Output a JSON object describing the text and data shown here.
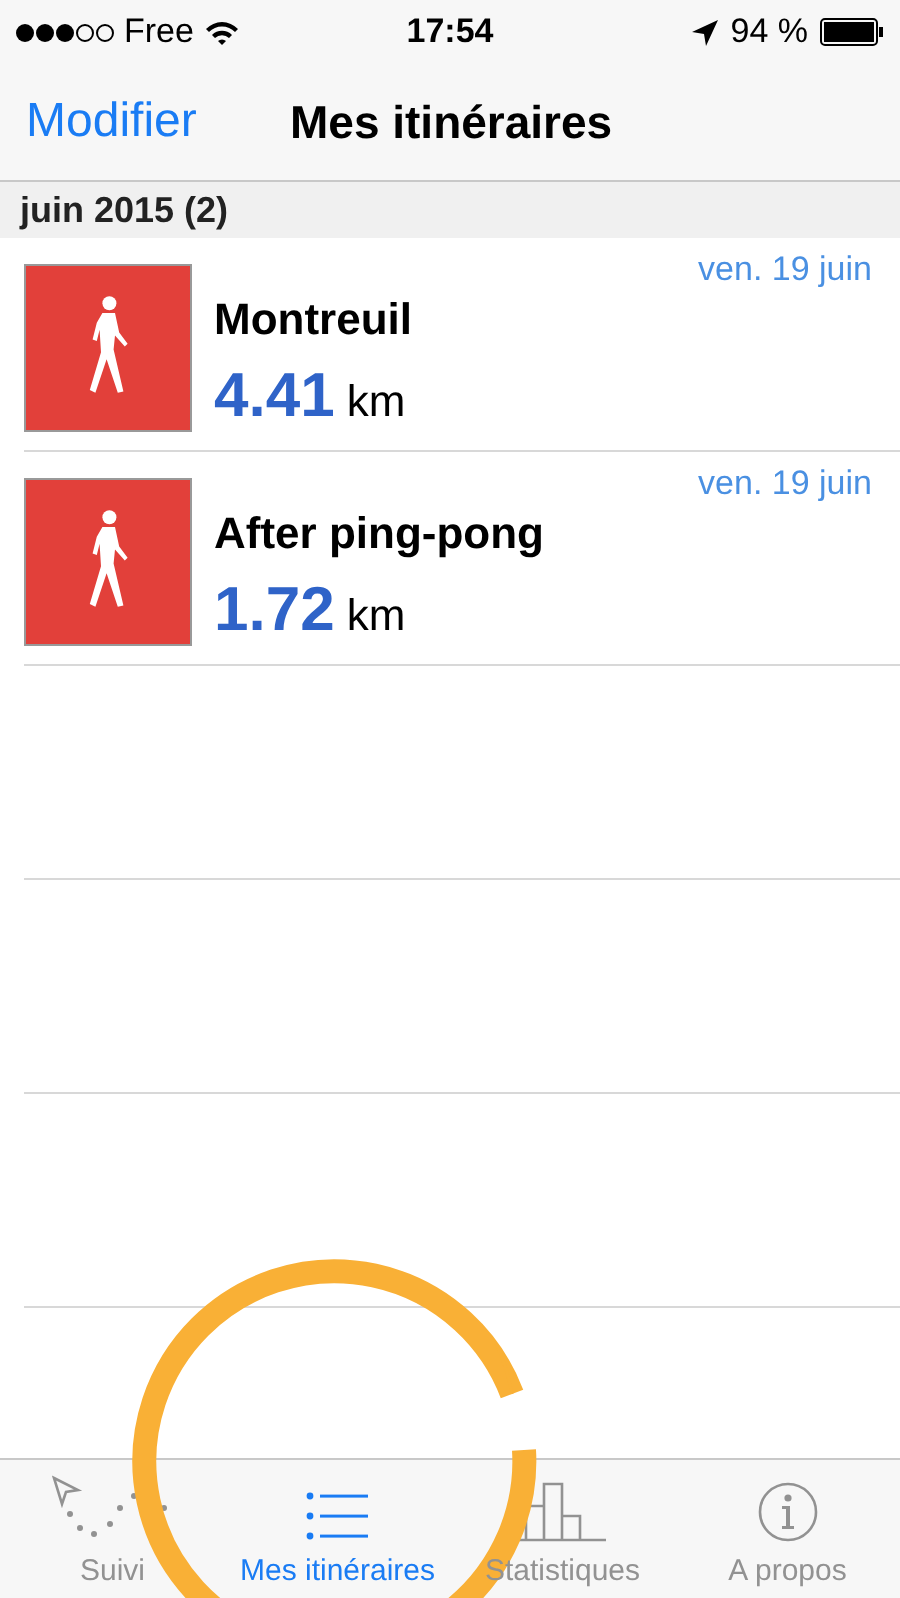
{
  "status_bar": {
    "carrier": "Free",
    "time": "17:54",
    "battery": "94 %"
  },
  "nav_bar": {
    "edit_button": "Modifier",
    "title": "Mes itinéraires"
  },
  "section": {
    "title": "juin 2015 (2)"
  },
  "routes": [
    {
      "name": "Montreuil",
      "distance": "4.41",
      "unit": "km",
      "date": "ven. 19 juin"
    },
    {
      "name": "After ping-pong",
      "distance": "1.72",
      "unit": "km",
      "date": "ven. 19 juin"
    }
  ],
  "tabs": [
    {
      "label": "Suivi",
      "kind": "track",
      "selected": false
    },
    {
      "label": "Mes itinéraires",
      "kind": "list",
      "selected": true
    },
    {
      "label": "Statistiques",
      "kind": "stats",
      "selected": false
    },
    {
      "label": "A propos",
      "kind": "info",
      "selected": false
    }
  ]
}
